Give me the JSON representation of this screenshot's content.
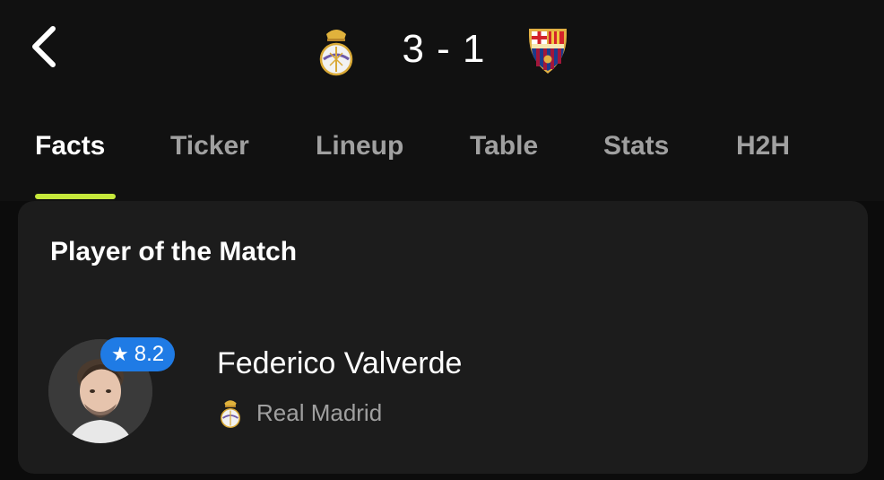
{
  "match": {
    "score": "3 - 1",
    "home_crest_icon": "real-madrid-crest-icon",
    "away_crest_icon": "barcelona-crest-icon"
  },
  "tabs": [
    {
      "label": "Facts",
      "active": true
    },
    {
      "label": "Ticker",
      "active": false
    },
    {
      "label": "Lineup",
      "active": false
    },
    {
      "label": "Table",
      "active": false
    },
    {
      "label": "Stats",
      "active": false
    },
    {
      "label": "H2H",
      "active": false
    }
  ],
  "potm": {
    "title": "Player of the Match",
    "player_name": "Federico Valverde",
    "rating": "8.2",
    "team_name": "Real Madrid",
    "team_icon": "real-madrid-crest-icon"
  },
  "colors": {
    "accent": "#c6e83b",
    "rating_badge": "#1f7be5",
    "card_bg": "#1c1c1c",
    "header_bg": "#111111"
  }
}
